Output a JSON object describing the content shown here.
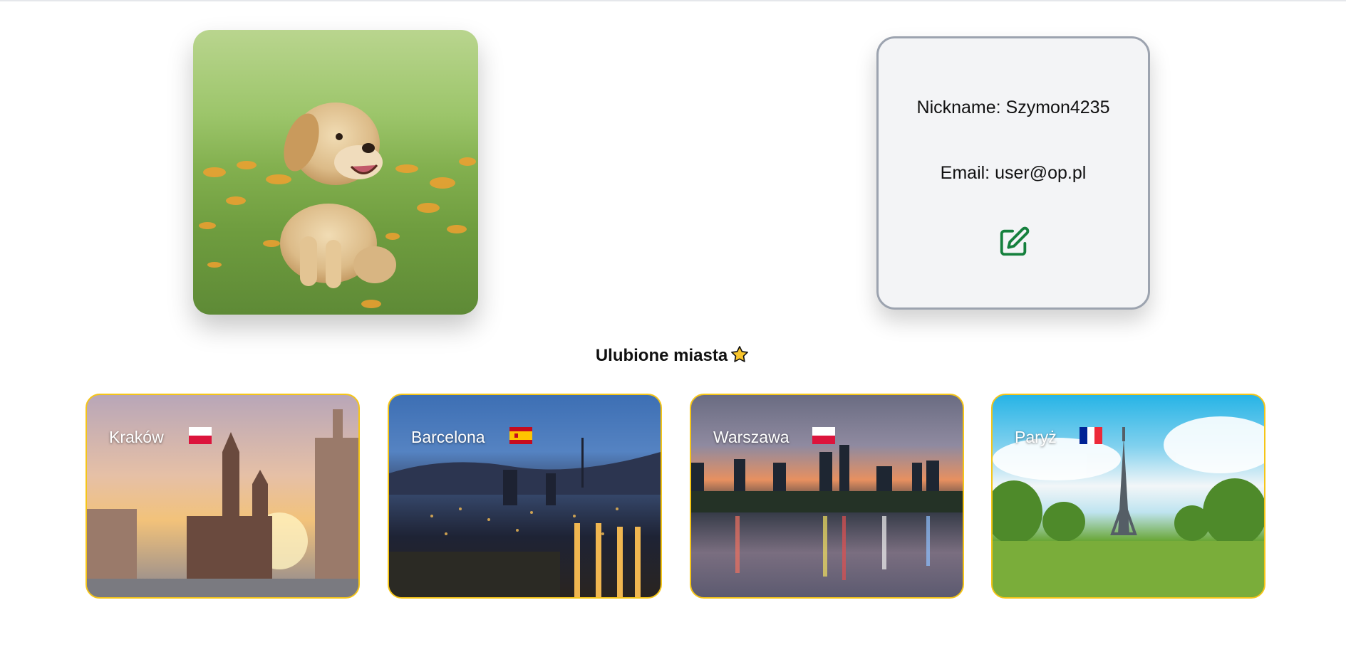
{
  "profile": {
    "avatar_alt": "puppy",
    "nickname_label": "Nickname: Szymon4235",
    "email_label": "Email: user@op.pl",
    "edit_icon": "edit-icon"
  },
  "favorites": {
    "title": "Ulubione miasta",
    "title_icon": "star-icon",
    "cities": [
      {
        "name": "Kraków",
        "flag": "poland-flag-icon"
      },
      {
        "name": "Barcelona",
        "flag": "spain-flag-icon"
      },
      {
        "name": "Warszawa",
        "flag": "poland-flag-icon"
      },
      {
        "name": "Paryż",
        "flag": "france-flag-icon"
      }
    ]
  },
  "colors": {
    "card_border": "#f5c518",
    "edit_icon": "#15803d",
    "info_card_bg": "#f3f4f6",
    "info_card_border": "#9ca3af"
  }
}
